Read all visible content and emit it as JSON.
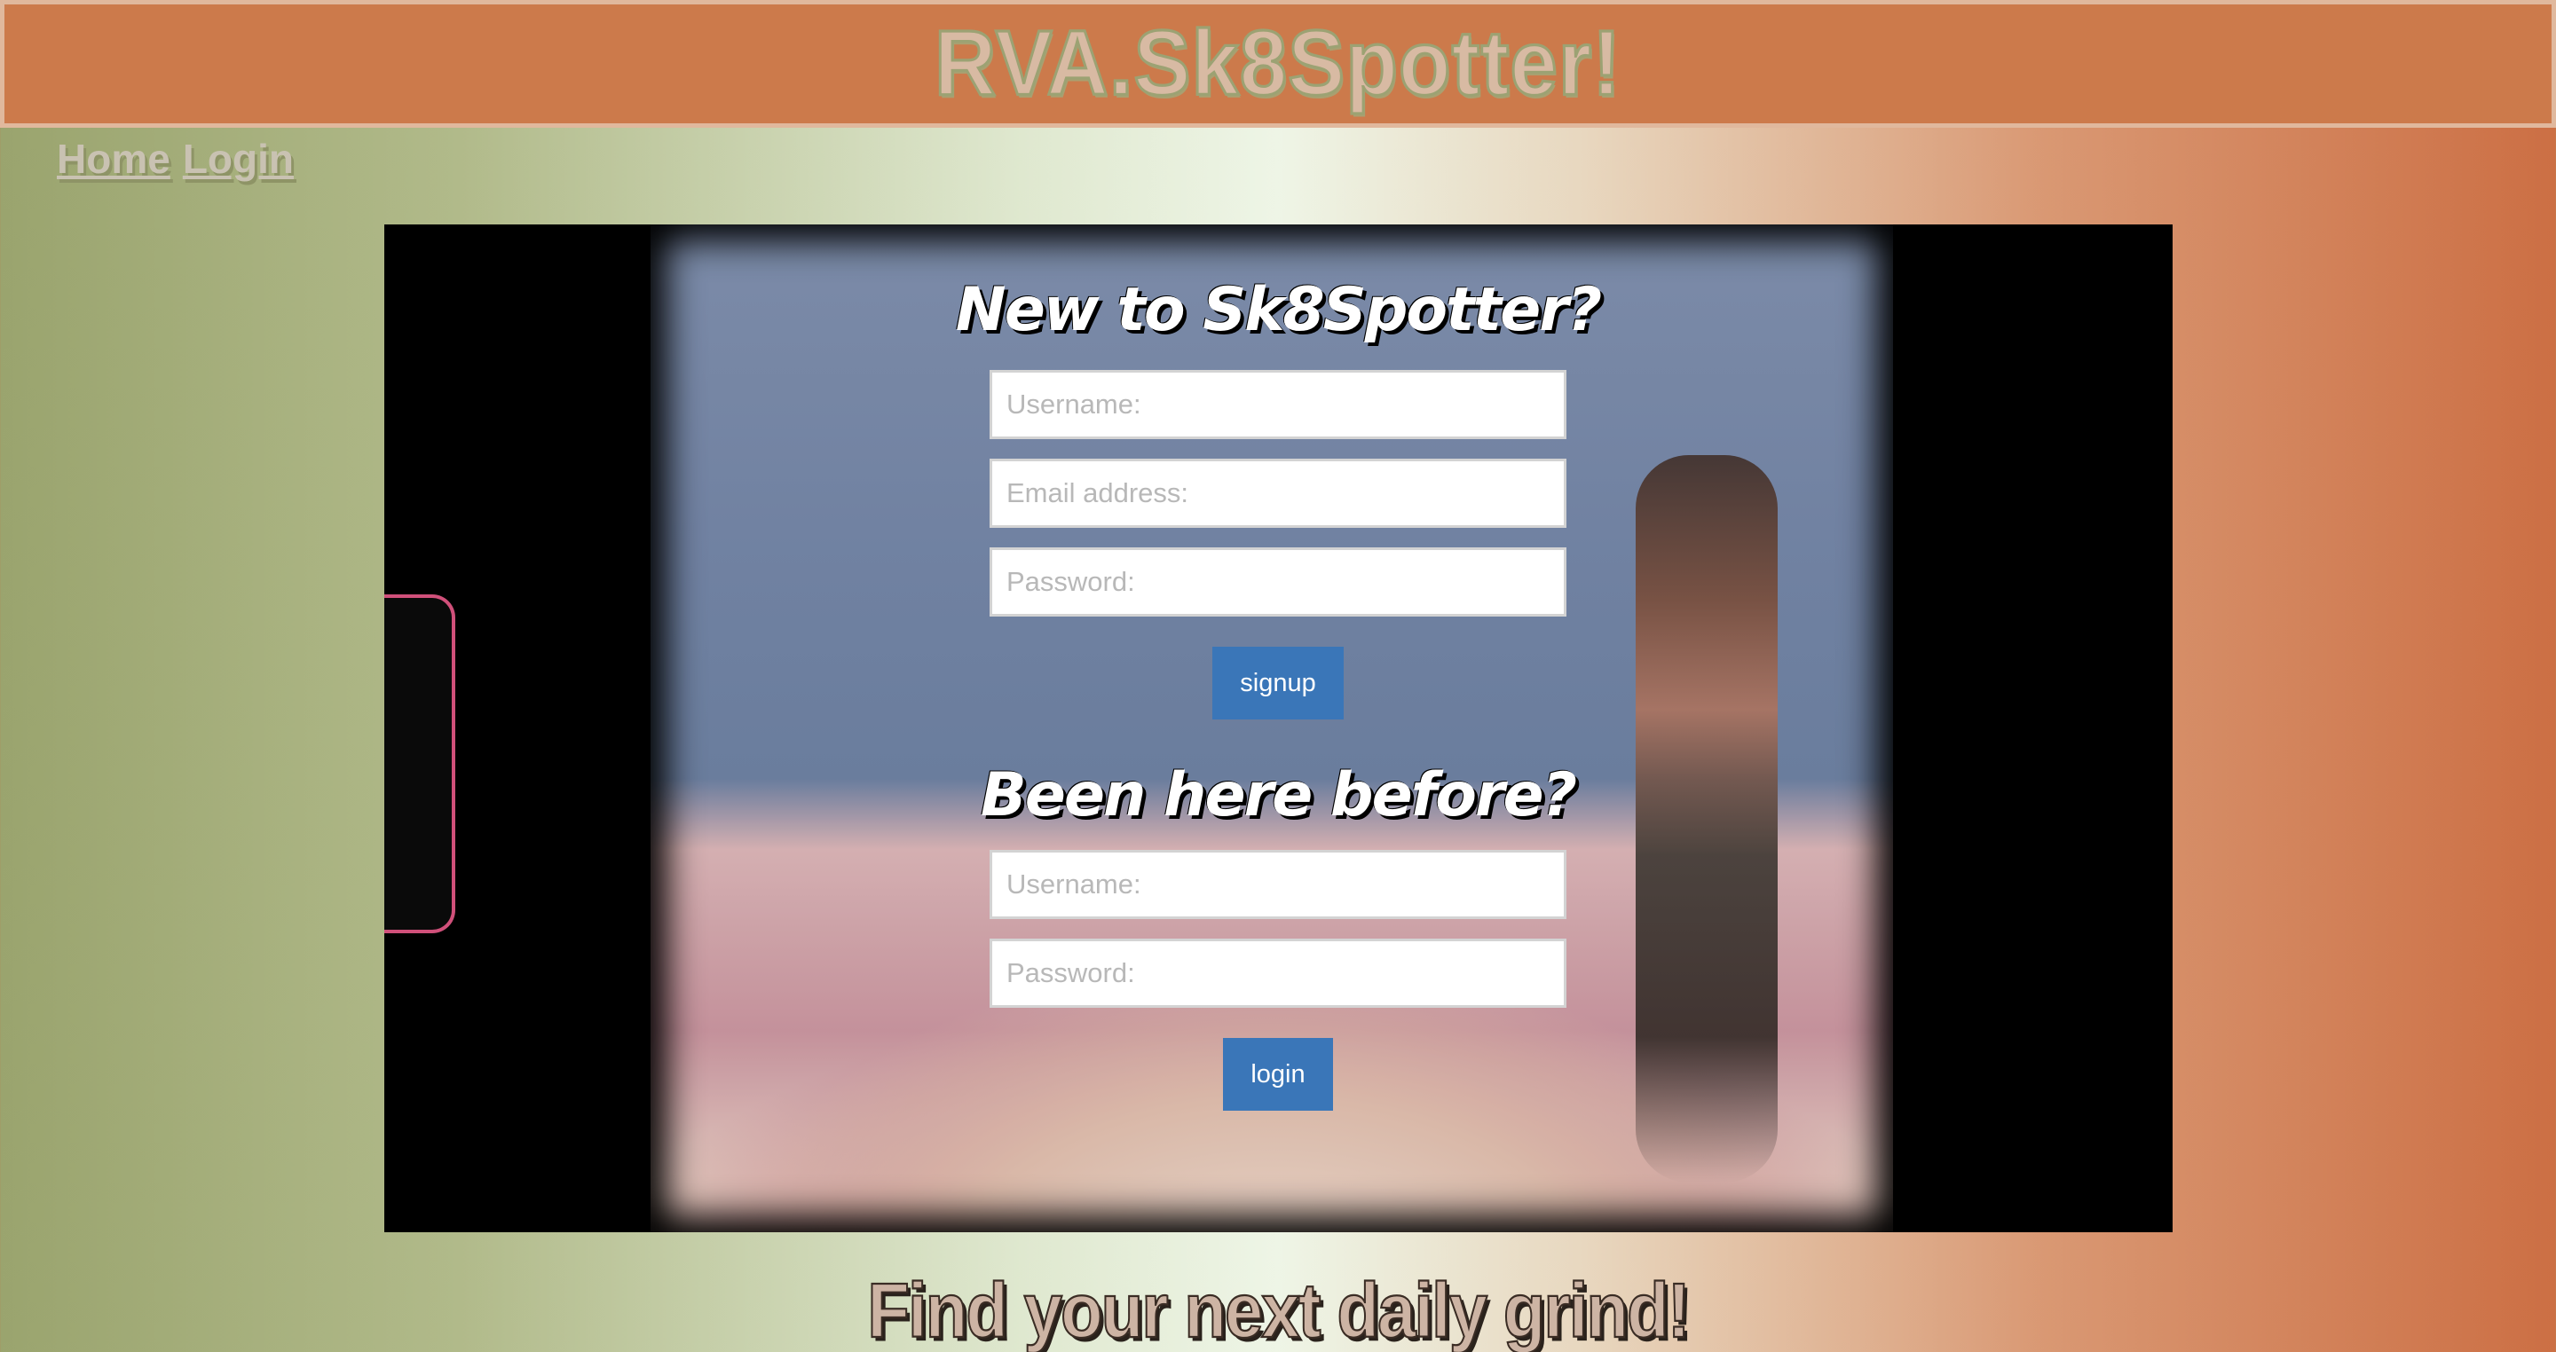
{
  "header": {
    "site_title": "RVA.Sk8Spotter!"
  },
  "nav": {
    "items": [
      {
        "label": "Home"
      },
      {
        "label": "Login"
      }
    ]
  },
  "signup": {
    "heading": "New to Sk8Spotter?",
    "username_placeholder": "Username:",
    "email_placeholder": "Email address:",
    "password_placeholder": "Password:",
    "button_label": "signup"
  },
  "login": {
    "heading": "Been here before?",
    "username_placeholder": "Username:",
    "password_placeholder": "Password:",
    "button_label": "login"
  },
  "footer": {
    "tagline": "Find your next daily grind!"
  },
  "colors": {
    "header_bg": "#cc7a4b",
    "button_bg": "#3a76b8"
  }
}
